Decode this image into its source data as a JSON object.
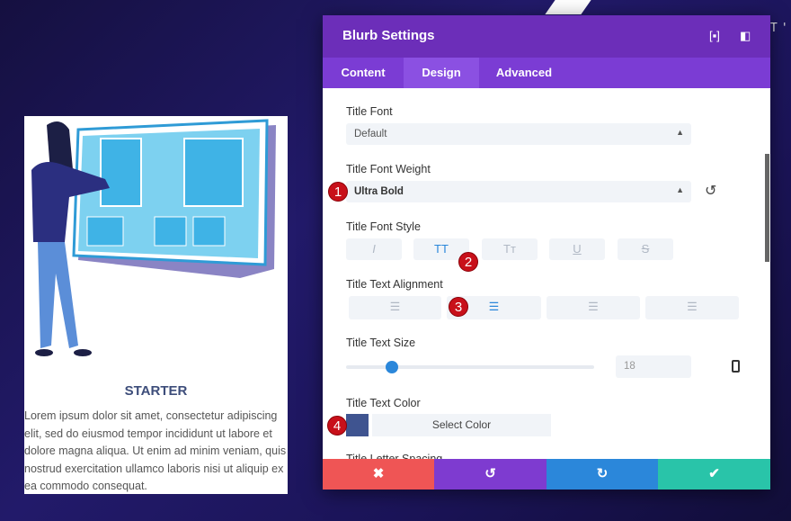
{
  "background": {
    "text": "T'S"
  },
  "card": {
    "title": "STARTER",
    "body": "Lorem ipsum dolor sit amet, consectetur adipiscing elit, sed do eiusmod tempor incididunt ut labore et dolore magna aliqua. Ut enim ad minim veniam, quis nostrud exercitation ullamco laboris nisi ut aliquip ex ea commodo consequat."
  },
  "modal": {
    "title": "Blurb Settings",
    "header_icons": [
      "fullscreen-icon",
      "sidebar-layout-icon"
    ],
    "tabs": [
      {
        "label": "Content"
      },
      {
        "label": "Design",
        "active": true
      },
      {
        "label": "Advanced"
      }
    ],
    "fields": {
      "title_font": {
        "label": "Title Font",
        "value": "Default"
      },
      "title_font_weight": {
        "label": "Title Font Weight",
        "value": "Ultra Bold"
      },
      "title_font_style": {
        "label": "Title Font Style",
        "options": [
          "I",
          "TT",
          "Tт",
          "U",
          "S"
        ],
        "active": "TT"
      },
      "title_text_alignment": {
        "label": "Title Text Alignment",
        "options": [
          "left",
          "center",
          "right",
          "justify"
        ],
        "active": "center"
      },
      "title_text_size": {
        "label": "Title Text Size",
        "value": "18"
      },
      "title_text_color": {
        "label": "Title Text Color",
        "button": "Select Color",
        "color": "#3f5490"
      },
      "next_label": "Title Letter Spacing"
    },
    "footer": [
      "cancel",
      "undo",
      "redo",
      "save"
    ],
    "colors": {
      "header": "#6c2eb9",
      "tabs": "#7b3cd4",
      "cancel": "#ef5555",
      "undo": "#7e3bd0",
      "redo": "#2b87da",
      "save": "#29c4a9"
    }
  },
  "badges": [
    "1",
    "2",
    "3",
    "4"
  ]
}
